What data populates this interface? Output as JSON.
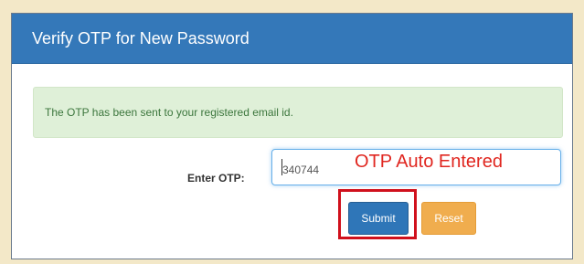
{
  "panel": {
    "title": "Verify OTP for New Password"
  },
  "alert": {
    "message": "The OTP has been sent to your registered email id."
  },
  "form": {
    "otp_label": "Enter OTP:",
    "otp_value": "340744"
  },
  "annotation": {
    "text": "OTP Auto Entered",
    "color": "#e0261f"
  },
  "buttons": {
    "submit_label": "Submit",
    "reset_label": "Reset"
  },
  "colors": {
    "header_blue": "#3478b9",
    "success_bg": "#dff0d8",
    "success_text": "#3c763d",
    "submit_blue": "#2f76b8",
    "reset_orange": "#f0ad4e",
    "highlight_red": "#d0101c"
  }
}
